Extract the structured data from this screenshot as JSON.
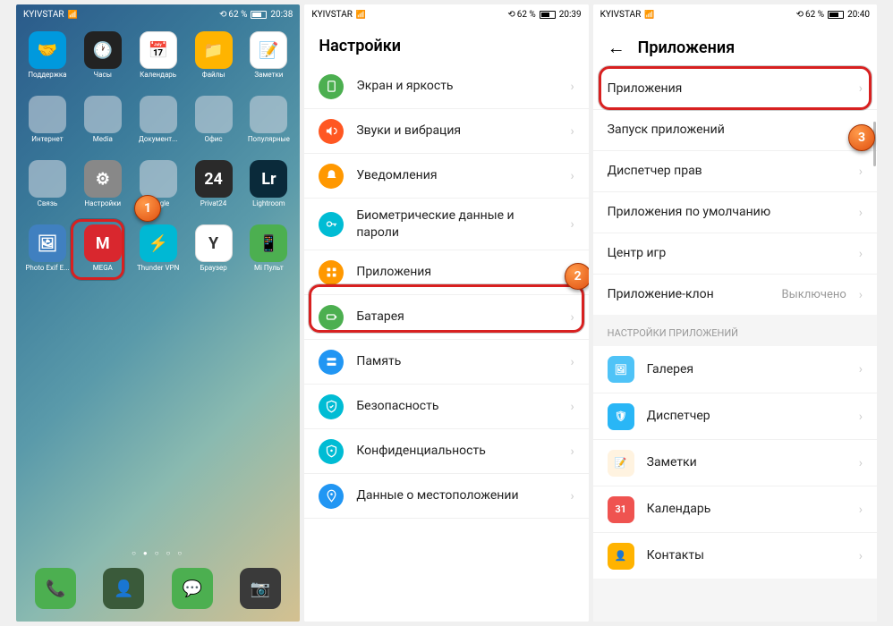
{
  "status": {
    "carrier": "KYIVSTAR",
    "battery": "62 %",
    "time1": "20:38",
    "time2": "20:39",
    "time3": "20:40",
    "rotate": "⟲"
  },
  "home": {
    "apps": [
      {
        "label": "Поддержка",
        "icon": "🤝",
        "color": "#0099dd"
      },
      {
        "label": "Часы",
        "icon": "🕐",
        "color": "#222"
      },
      {
        "label": "Календарь",
        "icon": "📅",
        "color": "#fff"
      },
      {
        "label": "Файлы",
        "icon": "📁",
        "color": "#ffb400"
      },
      {
        "label": "Заметки",
        "icon": "📝",
        "color": "#fff"
      },
      {
        "label": "Интернет",
        "icon": "folder",
        "color": ""
      },
      {
        "label": "Media",
        "icon": "folder",
        "color": ""
      },
      {
        "label": "Документ...",
        "icon": "folder",
        "color": ""
      },
      {
        "label": "Офис",
        "icon": "folder",
        "color": ""
      },
      {
        "label": "Популярные",
        "icon": "folder",
        "color": ""
      },
      {
        "label": "Связь",
        "icon": "folder",
        "color": ""
      },
      {
        "label": "Настройки",
        "icon": "⚙",
        "color": "#888"
      },
      {
        "label": "Google",
        "icon": "folder",
        "color": ""
      },
      {
        "label": "Privat24",
        "icon": "24",
        "color": "#2a2a2a"
      },
      {
        "label": "Lightroom",
        "icon": "Lr",
        "color": "#0a2a3a"
      },
      {
        "label": "Photo Exif E...",
        "icon": "🖼",
        "color": "#4080c0"
      },
      {
        "label": "MEGA",
        "icon": "M",
        "color": "#d9272e"
      },
      {
        "label": "Thunder VPN",
        "icon": "⚡",
        "color": "#00b8d4"
      },
      {
        "label": "Браузер",
        "icon": "Y",
        "color": "#fff"
      },
      {
        "label": "Mi Пульт",
        "icon": "📱",
        "color": "#4caf50"
      }
    ],
    "dock": [
      {
        "name": "phone",
        "icon": "📞",
        "color": "#4caf50"
      },
      {
        "name": "contacts",
        "icon": "👤",
        "color": "#3a5a3a"
      },
      {
        "name": "messages",
        "icon": "💬",
        "color": "#4caf50"
      },
      {
        "name": "camera",
        "icon": "📷",
        "color": "#3a3a3a"
      }
    ]
  },
  "settings": {
    "title": "Настройки",
    "rows": [
      {
        "label": "Экран и яркость",
        "color": "#4caf50",
        "icon": "display"
      },
      {
        "label": "Звуки и вибрация",
        "color": "#ff5722",
        "icon": "sound"
      },
      {
        "label": "Уведомления",
        "color": "#ff9800",
        "icon": "bell"
      },
      {
        "label": "Биометрические данные и пароли",
        "color": "#00bcd4",
        "icon": "key"
      },
      {
        "label": "Приложения",
        "color": "#ff9800",
        "icon": "apps"
      },
      {
        "label": "Батарея",
        "color": "#4caf50",
        "icon": "battery"
      },
      {
        "label": "Память",
        "color": "#2196f3",
        "icon": "storage"
      },
      {
        "label": "Безопасность",
        "color": "#00bcd4",
        "icon": "shield"
      },
      {
        "label": "Конфиденциальность",
        "color": "#00bcd4",
        "icon": "privacy"
      },
      {
        "label": "Данные о местоположении",
        "color": "#2196f3",
        "icon": "location"
      }
    ]
  },
  "apps": {
    "title": "Приложения",
    "rows": [
      {
        "label": "Приложения"
      },
      {
        "label": "Запуск приложений"
      },
      {
        "label": "Диспетчер прав"
      },
      {
        "label": "Приложения по умолчанию"
      },
      {
        "label": "Центр игр"
      },
      {
        "label": "Приложение-клон",
        "value": "Выключено"
      }
    ],
    "section": "НАСТРОЙКИ ПРИЛОЖЕНИЙ",
    "appRows": [
      {
        "label": "Галерея",
        "color": "#4fc3f7",
        "icon": "🖼"
      },
      {
        "label": "Диспетчер",
        "color": "#29b6f6",
        "icon": "🛡"
      },
      {
        "label": "Заметки",
        "color": "#fff3e0",
        "icon": "📝"
      },
      {
        "label": "Календарь",
        "color": "#ef5350",
        "icon": "31"
      },
      {
        "label": "Контакты",
        "color": "#ffb300",
        "icon": "👤"
      }
    ]
  },
  "markers": {
    "m1": "1",
    "m2": "2",
    "m3": "3"
  }
}
